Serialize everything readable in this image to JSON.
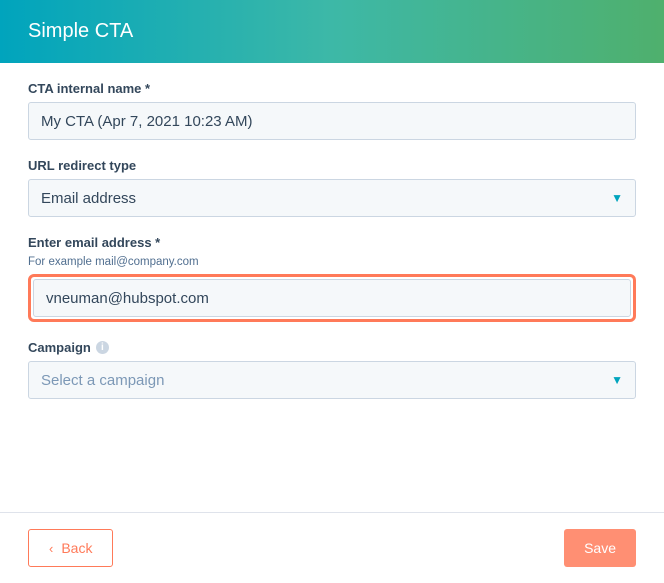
{
  "header": {
    "title": "Simple CTA"
  },
  "fields": {
    "name": {
      "label": "CTA internal name *",
      "value": "My CTA (Apr 7, 2021 10:23 AM)"
    },
    "redirect": {
      "label": "URL redirect type",
      "value": "Email address"
    },
    "email": {
      "label": "Enter email address *",
      "help": "For example mail@company.com",
      "value": "vneuman@hubspot.com"
    },
    "campaign": {
      "label": "Campaign",
      "placeholder": "Select a campaign"
    }
  },
  "footer": {
    "back": "Back",
    "save": "Save"
  }
}
